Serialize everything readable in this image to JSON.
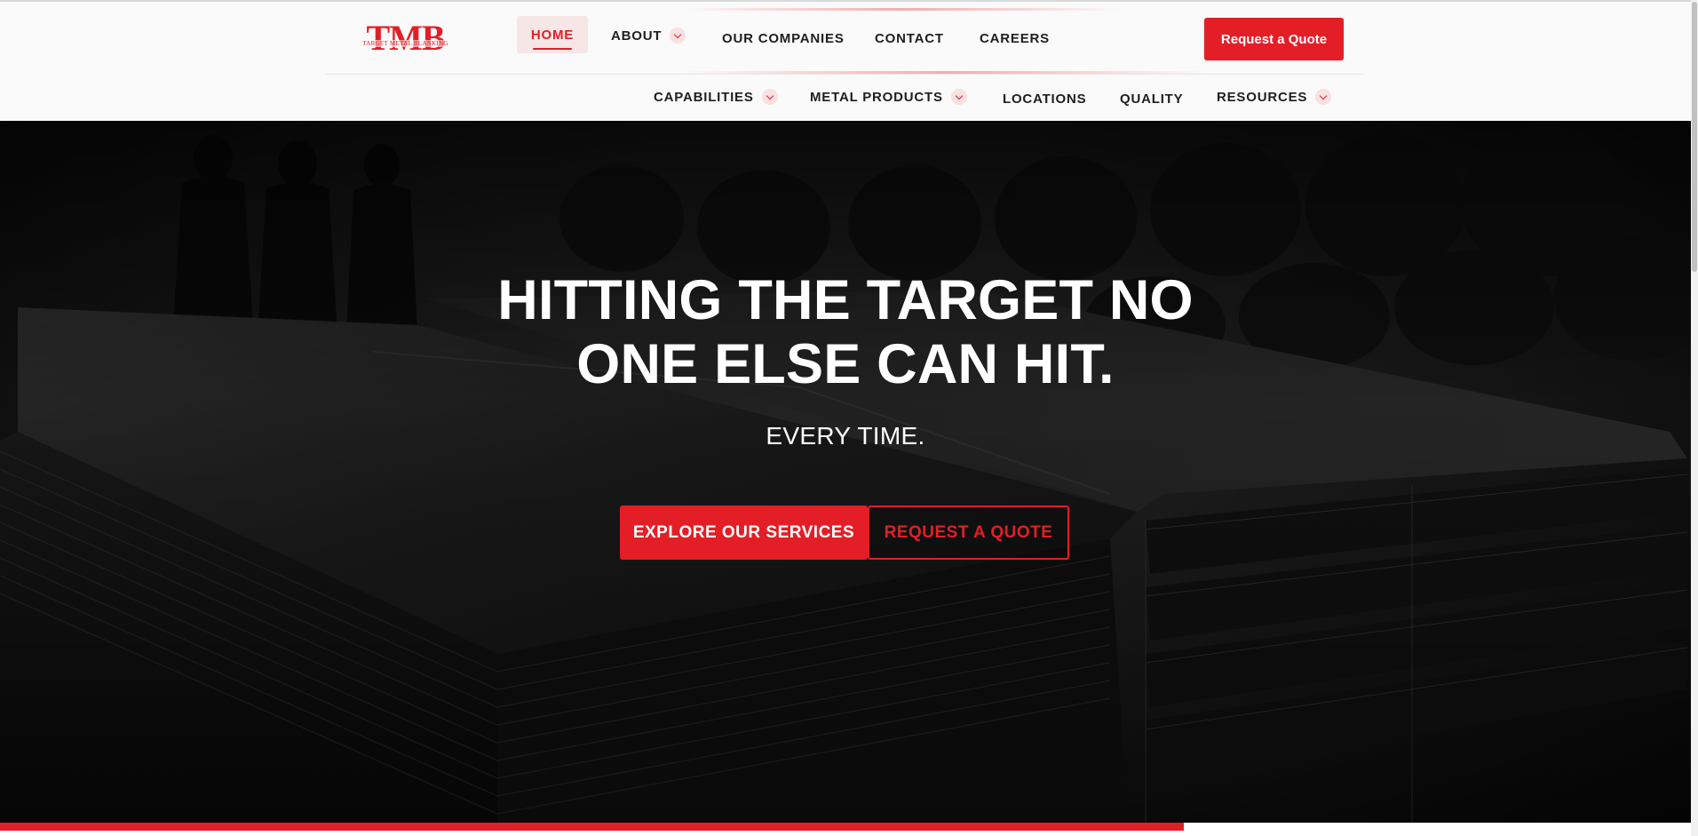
{
  "brand": {
    "logo_text": "TMB",
    "logo_subtext": "TARGET METAL BLANKING",
    "accent_color": "#e41e26"
  },
  "nav": {
    "primary": [
      {
        "label": "HOME",
        "active": true,
        "has_dropdown": false
      },
      {
        "label": "ABOUT",
        "active": false,
        "has_dropdown": true
      },
      {
        "label": "OUR COMPANIES",
        "active": false,
        "has_dropdown": false
      },
      {
        "label": "CONTACT",
        "active": false,
        "has_dropdown": false
      },
      {
        "label": "CAREERS",
        "active": false,
        "has_dropdown": false
      }
    ],
    "secondary": [
      {
        "label": "CAPABILITIES",
        "has_dropdown": true
      },
      {
        "label": "METAL PRODUCTS",
        "has_dropdown": true
      },
      {
        "label": "LOCATIONS",
        "has_dropdown": false
      },
      {
        "label": "QUALITY",
        "has_dropdown": false
      },
      {
        "label": "RESOURCES",
        "has_dropdown": true
      }
    ],
    "quote_button": "Request a Quote"
  },
  "hero": {
    "title_line1": "HITTING THE TARGET NO",
    "title_line2": "ONE ELSE CAN HIT.",
    "subtitle": "EVERY TIME.",
    "primary_cta": "EXPLORE OUR SERVICES",
    "secondary_cta": "REQUEST A QUOTE"
  },
  "bottom_strip": {
    "progress_fraction": 0.7
  }
}
